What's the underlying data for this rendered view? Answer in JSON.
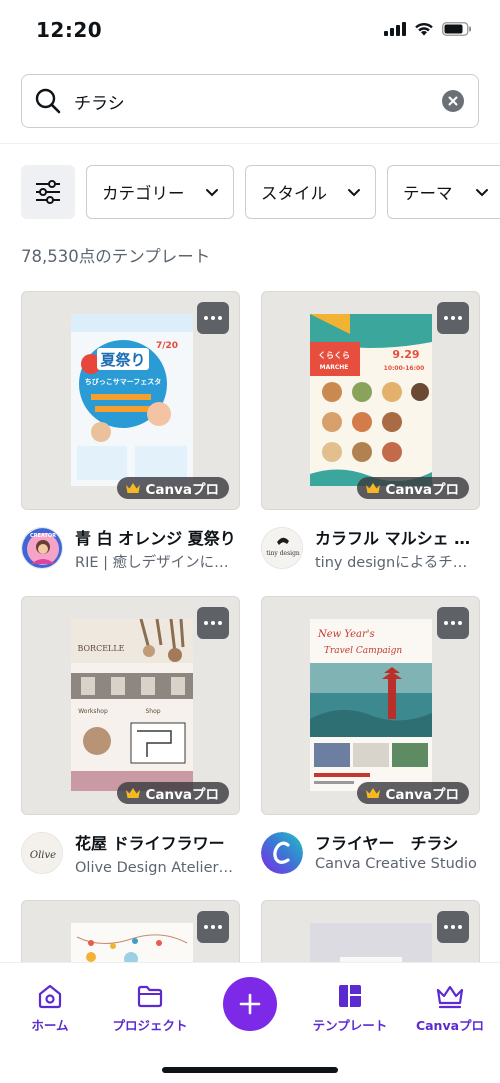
{
  "status_bar": {
    "time": "12:20"
  },
  "search": {
    "value": "チラシ"
  },
  "filters": {
    "category": "カテゴリー",
    "style": "スタイル",
    "theme": "テーマ"
  },
  "result_count": "78,530点のテンプレート",
  "badge_label": "Canvaプロ",
  "cards": [
    {
      "title": "青 白 オレンジ 夏祭り",
      "author": "RIE | 癒しデザインによるチラシ",
      "poster_text": [
        "夏祭り",
        "ちびっこサマーフェスタ",
        "7/20"
      ]
    },
    {
      "title": "カラフル マルシェ チラシ",
      "author": "tiny designによるチラシ",
      "poster_text": [
        "くらくら",
        "MARCHE",
        "9.29",
        "10:00-16:00"
      ]
    },
    {
      "title": "花屋 ドライフラワー",
      "author": "Olive Design Atelierによる",
      "poster_text": [
        "BORCELLE",
        "Workshop",
        "Shop"
      ]
    },
    {
      "title": "フライヤー　チラシ",
      "author": "Canva Creative Studio",
      "poster_text": [
        "New Year's",
        "Travel Campaign"
      ]
    }
  ],
  "avatars": {
    "rie": "CREATOR",
    "tiny": "tiny design",
    "olive": "Olive"
  },
  "nav": {
    "home": "ホーム",
    "projects": "プロジェクト",
    "templates": "テンプレート",
    "pro": "Canvaプロ"
  },
  "colors": {
    "accent": "#7d2ae8",
    "nav_text": "#5b2bd1"
  }
}
